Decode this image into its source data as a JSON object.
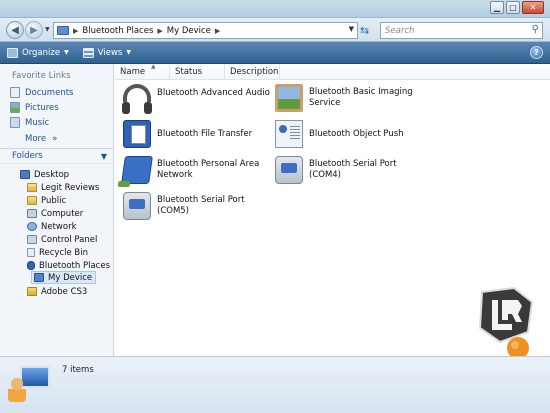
{
  "window": {
    "buttons": [
      "minimize",
      "maximize",
      "close"
    ]
  },
  "address": {
    "breadcrumbs": [
      "Bluetooth Places",
      "My Device"
    ],
    "search_placeholder": "Search"
  },
  "toolbar": {
    "organize_label": "Organize",
    "views_label": "Views"
  },
  "nav": {
    "favorites_header": "Favorite Links",
    "favorites": [
      {
        "label": "Documents",
        "icon": "documents-icon"
      },
      {
        "label": "Pictures",
        "icon": "pictures-icon"
      },
      {
        "label": "Music",
        "icon": "music-icon"
      }
    ],
    "more_label": "More",
    "more_glyph": "»",
    "folders_header": "Folders",
    "tree": [
      {
        "label": "Desktop",
        "icon": "desktop-icon"
      },
      {
        "label": "Legit Reviews",
        "icon": "folder-icon"
      },
      {
        "label": "Public",
        "icon": "folder-icon"
      },
      {
        "label": "Computer",
        "icon": "computer-icon"
      },
      {
        "label": "Network",
        "icon": "network-icon"
      },
      {
        "label": "Control Panel",
        "icon": "control-panel-icon"
      },
      {
        "label": "Recycle Bin",
        "icon": "recycle-bin-icon"
      },
      {
        "label": "Bluetooth Places",
        "icon": "bluetooth-icon"
      },
      {
        "label": "My Device",
        "icon": "device-icon",
        "selected": true
      },
      {
        "label": "Adobe CS3",
        "icon": "folder-icon"
      }
    ]
  },
  "content": {
    "columns": [
      "Name",
      "Status",
      "Description"
    ],
    "items": [
      {
        "label": "Bluetooth Advanced Audio",
        "icon": "headphones-icon"
      },
      {
        "label": "Bluetooth Basic Imaging Service",
        "icon": "imaging-icon"
      },
      {
        "label": "Bluetooth File Transfer",
        "icon": "file-transfer-icon"
      },
      {
        "label": "Bluetooth Object Push",
        "icon": "object-push-icon"
      },
      {
        "label": "Bluetooth Personal Area Network",
        "icon": "network-access-icon"
      },
      {
        "label": "Bluetooth Serial Port (COM4)",
        "icon": "serial-port-icon"
      },
      {
        "label": "Bluetooth Serial Port (COM5)",
        "icon": "serial-port-icon"
      }
    ]
  },
  "details": {
    "count_text": "7 items"
  },
  "colors": {
    "toolbar": "#30628f",
    "link": "#1e4d9b",
    "logo_orange": "#f0901e"
  }
}
